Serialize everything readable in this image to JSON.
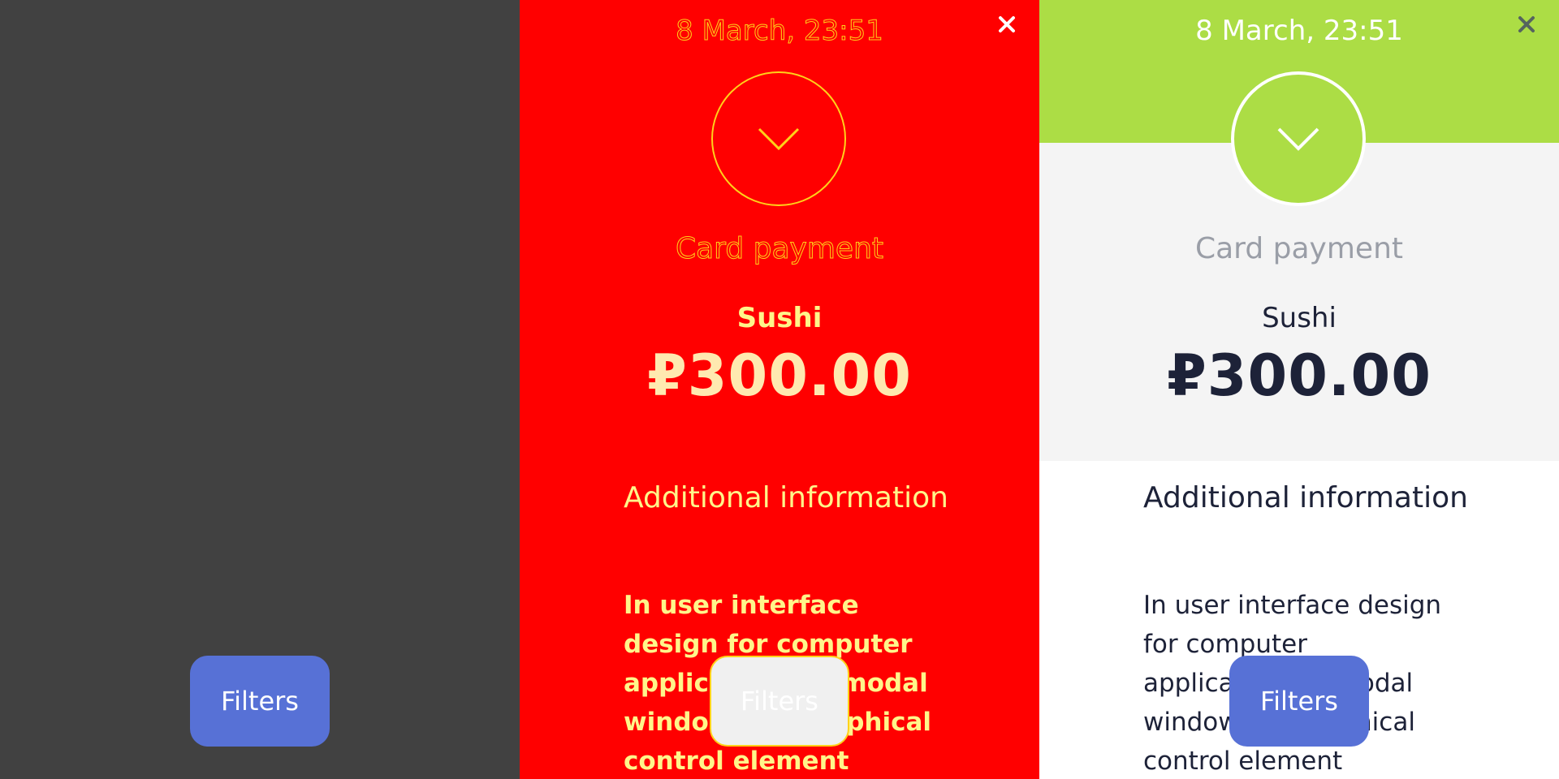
{
  "filters_label": "Filters",
  "receipt": {
    "date": "8 March, 23:51",
    "payment_type": "Card payment",
    "merchant": "Sushi",
    "amount": "₽300.00",
    "info_title": "Additional information",
    "info_text": "In user interface design for computer applications, a modal window is a graphical control element"
  },
  "icons": {
    "close": "close-icon",
    "status": "chevron-down-icon"
  },
  "colors": {
    "accent_green": "#acdd45",
    "button_blue": "#5771d6",
    "overlay_dark": "#414141",
    "highlight_red": "#ff0000",
    "outline_yellow": "#ffd21a",
    "text_dark": "#1d2238"
  }
}
